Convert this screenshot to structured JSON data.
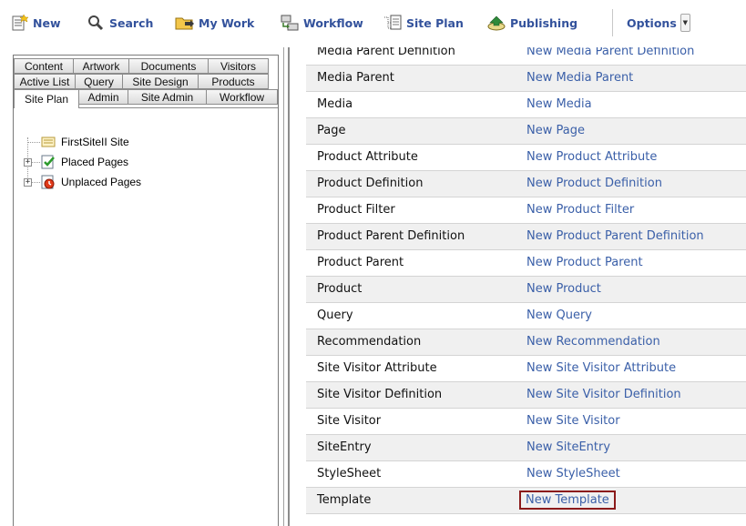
{
  "toolbar": {
    "items": [
      {
        "label": "New",
        "icon": "new-document-icon"
      },
      {
        "label": "Search",
        "icon": "magnifier-icon"
      },
      {
        "label": "My Work",
        "icon": "folder-arrow-icon"
      },
      {
        "label": "Workflow",
        "icon": "workflow-icon"
      },
      {
        "label": "Site Plan",
        "icon": "site-plan-icon"
      },
      {
        "label": "Publishing",
        "icon": "publishing-icon"
      }
    ],
    "options_label": "Options"
  },
  "tabs": {
    "row1": [
      "Content",
      "Artwork",
      "Documents",
      "Visitors"
    ],
    "row2": [
      "Active List",
      "Query",
      "Site Design",
      "Products"
    ],
    "row3": [
      "Site Plan",
      "Admin",
      "Site Admin",
      "Workflow"
    ],
    "active": "Site Plan"
  },
  "tree": {
    "root": "FirstSiteII Site",
    "nodes": [
      {
        "label": "Placed Pages",
        "icon": "placed-pages-icon"
      },
      {
        "label": "Unplaced Pages",
        "icon": "unplaced-pages-icon"
      }
    ]
  },
  "asset_types": [
    {
      "name": "Media Parent Definition",
      "link": "New Media Parent Definition"
    },
    {
      "name": "Media Parent",
      "link": "New Media Parent"
    },
    {
      "name": "Media",
      "link": "New Media"
    },
    {
      "name": "Page",
      "link": "New Page"
    },
    {
      "name": "Product Attribute",
      "link": "New Product Attribute"
    },
    {
      "name": "Product Definition",
      "link": "New Product Definition"
    },
    {
      "name": "Product Filter",
      "link": "New Product Filter"
    },
    {
      "name": "Product Parent Definition",
      "link": "New Product Parent Definition"
    },
    {
      "name": "Product Parent",
      "link": "New Product Parent"
    },
    {
      "name": "Product",
      "link": "New Product"
    },
    {
      "name": "Query",
      "link": "New Query"
    },
    {
      "name": "Recommendation",
      "link": "New Recommendation"
    },
    {
      "name": "Site Visitor Attribute",
      "link": "New Site Visitor Attribute"
    },
    {
      "name": "Site Visitor Definition",
      "link": "New Site Visitor Definition"
    },
    {
      "name": "Site Visitor",
      "link": "New Site Visitor"
    },
    {
      "name": "SiteEntry",
      "link": "New SiteEntry"
    },
    {
      "name": "StyleSheet",
      "link": "New StyleSheet"
    },
    {
      "name": "Template",
      "link": "New Template"
    }
  ],
  "highlighted_link": "New Template",
  "colors": {
    "link": "#3a5fa8",
    "toolbar_text": "#33529c",
    "highlight_border": "#8b1a1a"
  }
}
